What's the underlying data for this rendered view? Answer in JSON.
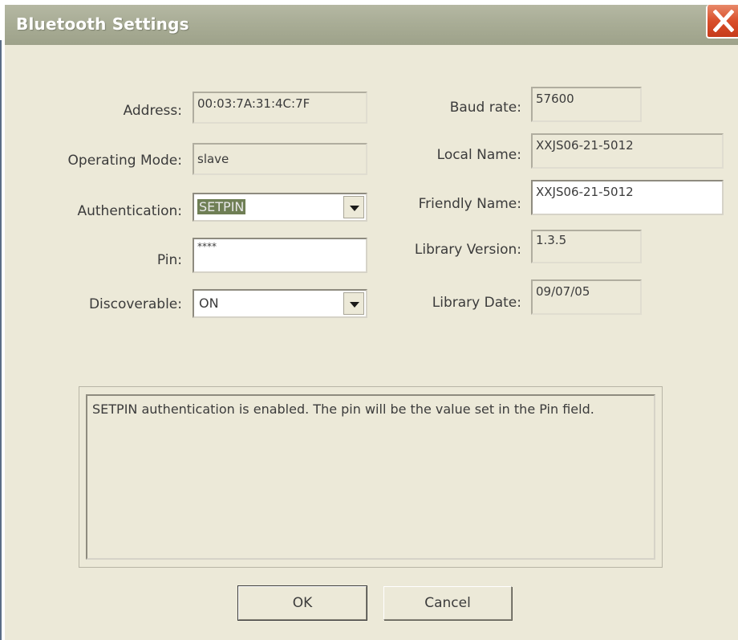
{
  "window": {
    "title": "Bluetooth Settings"
  },
  "left": {
    "address": {
      "label": "Address:",
      "value": "00:03:7A:31:4C:7F"
    },
    "operating_mode": {
      "label": "Operating Mode:",
      "value": "slave"
    },
    "authentication": {
      "label": "Authentication:",
      "value": "SETPIN"
    },
    "pin": {
      "label": "Pin:",
      "value": "****"
    },
    "discoverable": {
      "label": "Discoverable:",
      "value": "ON"
    }
  },
  "right": {
    "baud_rate": {
      "label": "Baud rate:",
      "value": "57600"
    },
    "local_name": {
      "label": "Local Name:",
      "value": "XXJS06-21-5012"
    },
    "friendly_name": {
      "label": "Friendly Name:",
      "value": "XXJS06-21-5012"
    },
    "library_version": {
      "label": "Library Version:",
      "value": "1.3.5"
    },
    "library_date": {
      "label": "Library Date:",
      "value": "09/07/05"
    }
  },
  "message": "SETPIN authentication is enabled.  The pin will be the value set in the Pin field.",
  "buttons": {
    "ok": "OK",
    "cancel": "Cancel"
  },
  "icons": {
    "close": "close-icon",
    "dropdown": "chevron-down-icon"
  }
}
